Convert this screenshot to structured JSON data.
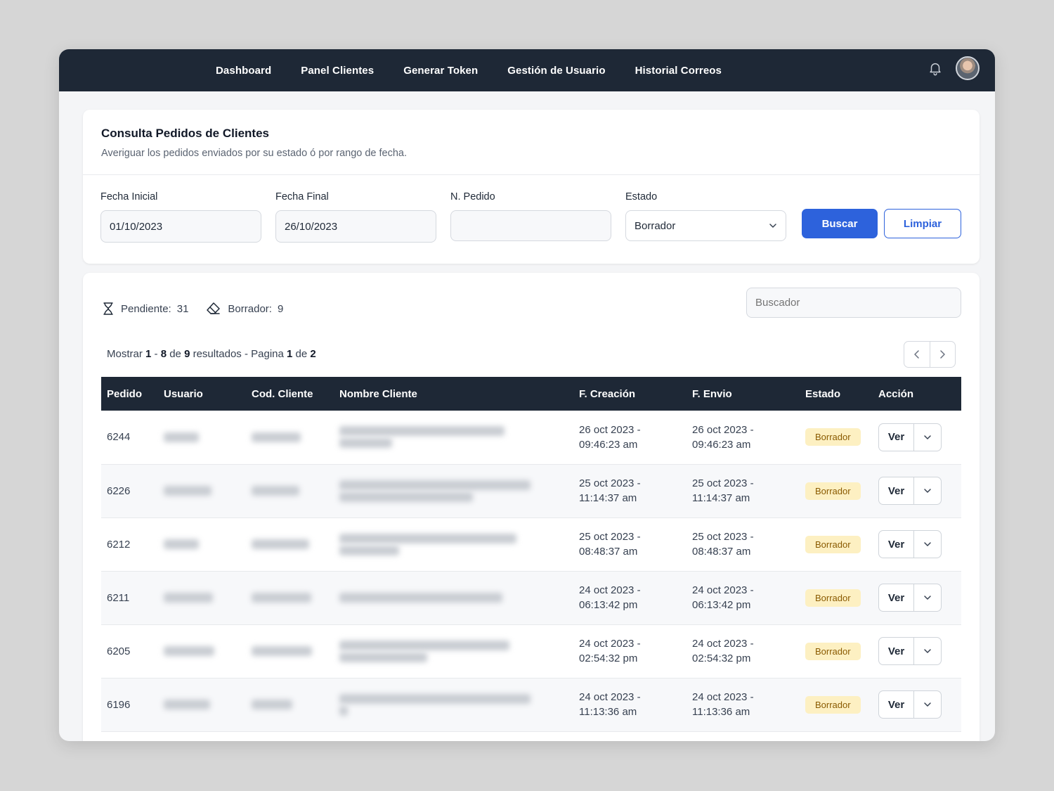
{
  "nav": {
    "links": [
      "Dashboard",
      "Panel Clientes",
      "Generar Token",
      "Gestión de Usuario",
      "Historial Correos"
    ]
  },
  "consulta": {
    "title": "Consulta Pedidos de Clientes",
    "subtitle": "Averiguar los pedidos enviados por su estado ó por rango de fecha.",
    "fecha_inicial_label": "Fecha Inicial",
    "fecha_inicial_value": "01/10/2023",
    "fecha_final_label": "Fecha Final",
    "fecha_final_value": "26/10/2023",
    "pedido_label": "N. Pedido",
    "pedido_value": "",
    "estado_label": "Estado",
    "estado_value": "Borrador",
    "buscar_label": "Buscar",
    "limpiar_label": "Limpiar"
  },
  "stats": {
    "pendiente_label": "Pendiente:",
    "pendiente_value": "31",
    "borrador_label": "Borrador:",
    "borrador_value": "9"
  },
  "search": {
    "placeholder": "Buscador"
  },
  "summary": {
    "prefix": "Mostrar",
    "from": "1",
    "sep": "-",
    "to": "8",
    "de": "de",
    "total": "9",
    "resultados": "resultados - Pagina",
    "page": "1",
    "de2": "de",
    "pages": "2"
  },
  "table": {
    "headers": [
      "Pedido",
      "Usuario",
      "Cod. Cliente",
      "Nombre Cliente",
      "F. Creación",
      "F. Envio",
      "Estado",
      "Acción"
    ],
    "rows": [
      {
        "pedido": "6244",
        "creacion_1": "26 oct 2023 -",
        "creacion_2": "09:46:23 am",
        "envio_1": "26 oct 2023 -",
        "envio_2": "09:46:23 am",
        "estado": "Borrador",
        "accion": "Ver"
      },
      {
        "pedido": "6226",
        "creacion_1": "25 oct 2023 -",
        "creacion_2": "11:14:37 am",
        "envio_1": "25 oct 2023 -",
        "envio_2": "11:14:37 am",
        "estado": "Borrador",
        "accion": "Ver"
      },
      {
        "pedido": "6212",
        "creacion_1": "25 oct 2023 -",
        "creacion_2": "08:48:37 am",
        "envio_1": "25 oct 2023 -",
        "envio_2": "08:48:37 am",
        "estado": "Borrador",
        "accion": "Ver"
      },
      {
        "pedido": "6211",
        "creacion_1": "24 oct 2023 -",
        "creacion_2": "06:13:42 pm",
        "envio_1": "24 oct 2023 -",
        "envio_2": "06:13:42 pm",
        "estado": "Borrador",
        "accion": "Ver"
      },
      {
        "pedido": "6205",
        "creacion_1": "24 oct 2023 -",
        "creacion_2": "02:54:32 pm",
        "envio_1": "24 oct 2023 -",
        "envio_2": "02:54:32 pm",
        "estado": "Borrador",
        "accion": "Ver"
      },
      {
        "pedido": "6196",
        "creacion_1": "24 oct 2023 -",
        "creacion_2": "11:13:36 am",
        "envio_1": "24 oct 2023 -",
        "envio_2": "11:13:36 am",
        "estado": "Borrador",
        "accion": "Ver"
      }
    ]
  },
  "colors": {
    "nav_bg": "#1e2836",
    "accent": "#2d62dc",
    "badge_bg": "#fdf0c2"
  }
}
